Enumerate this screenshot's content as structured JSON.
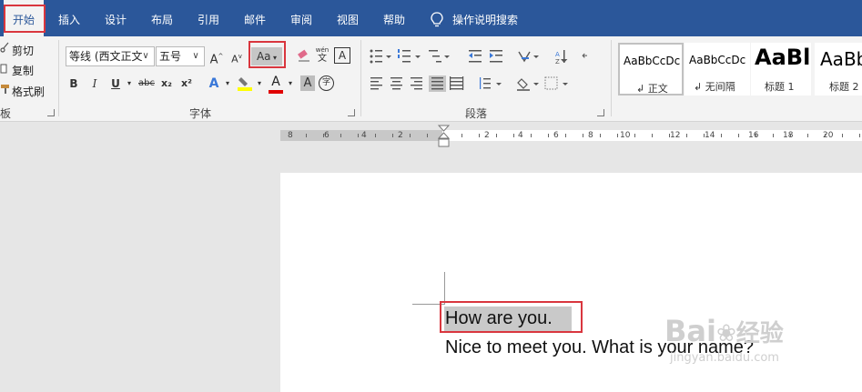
{
  "menubar": {
    "tabs": [
      "开始",
      "插入",
      "设计",
      "布局",
      "引用",
      "邮件",
      "审阅",
      "视图",
      "帮助"
    ],
    "active_tab": "开始",
    "tell_me": "操作说明搜索"
  },
  "clipboard": {
    "cut": "剪切",
    "copy": "复制",
    "format_painter": "格式刷",
    "label": "板"
  },
  "font": {
    "family": "等线 (西文正文",
    "size": "五号",
    "change_case": "Aa",
    "pinyin_glyph": "wén",
    "pinyin_char": "文",
    "border_char": "A",
    "bold": "B",
    "italic": "I",
    "underline": "U",
    "strike": "abc",
    "subscript": "x₂",
    "superscript": "x²",
    "effects": "A",
    "color_a": "A",
    "shading_a": "A",
    "enclose_char": "字",
    "highlight_color": "#ffff00",
    "font_color": "#e00000",
    "label": "字体"
  },
  "paragraph": {
    "label": "段落"
  },
  "styles": {
    "items": [
      {
        "sample": "AaBbCcDc",
        "name": "正文"
      },
      {
        "sample": "AaBbCcDc",
        "name": "无间隔"
      },
      {
        "sample": "AaBl",
        "name": "标题 1"
      },
      {
        "sample": "AaBb",
        "name": "标题 2"
      }
    ]
  },
  "ruler": {
    "left_numbers": [
      "8",
      "6",
      "4",
      "2"
    ],
    "right_numbers": [
      "2",
      "4",
      "6",
      "8",
      "10",
      "12",
      "14",
      "16",
      "18",
      "20"
    ]
  },
  "document": {
    "line1": "How are you.",
    "line2": "Nice to meet you. What is your name?"
  },
  "watermark": {
    "brand": "Bai",
    "brand2": "经验",
    "url": "jingyan.baidu.com"
  },
  "colors": {
    "ribbon_blue": "#2b579a",
    "callout_red": "#d9363e"
  }
}
